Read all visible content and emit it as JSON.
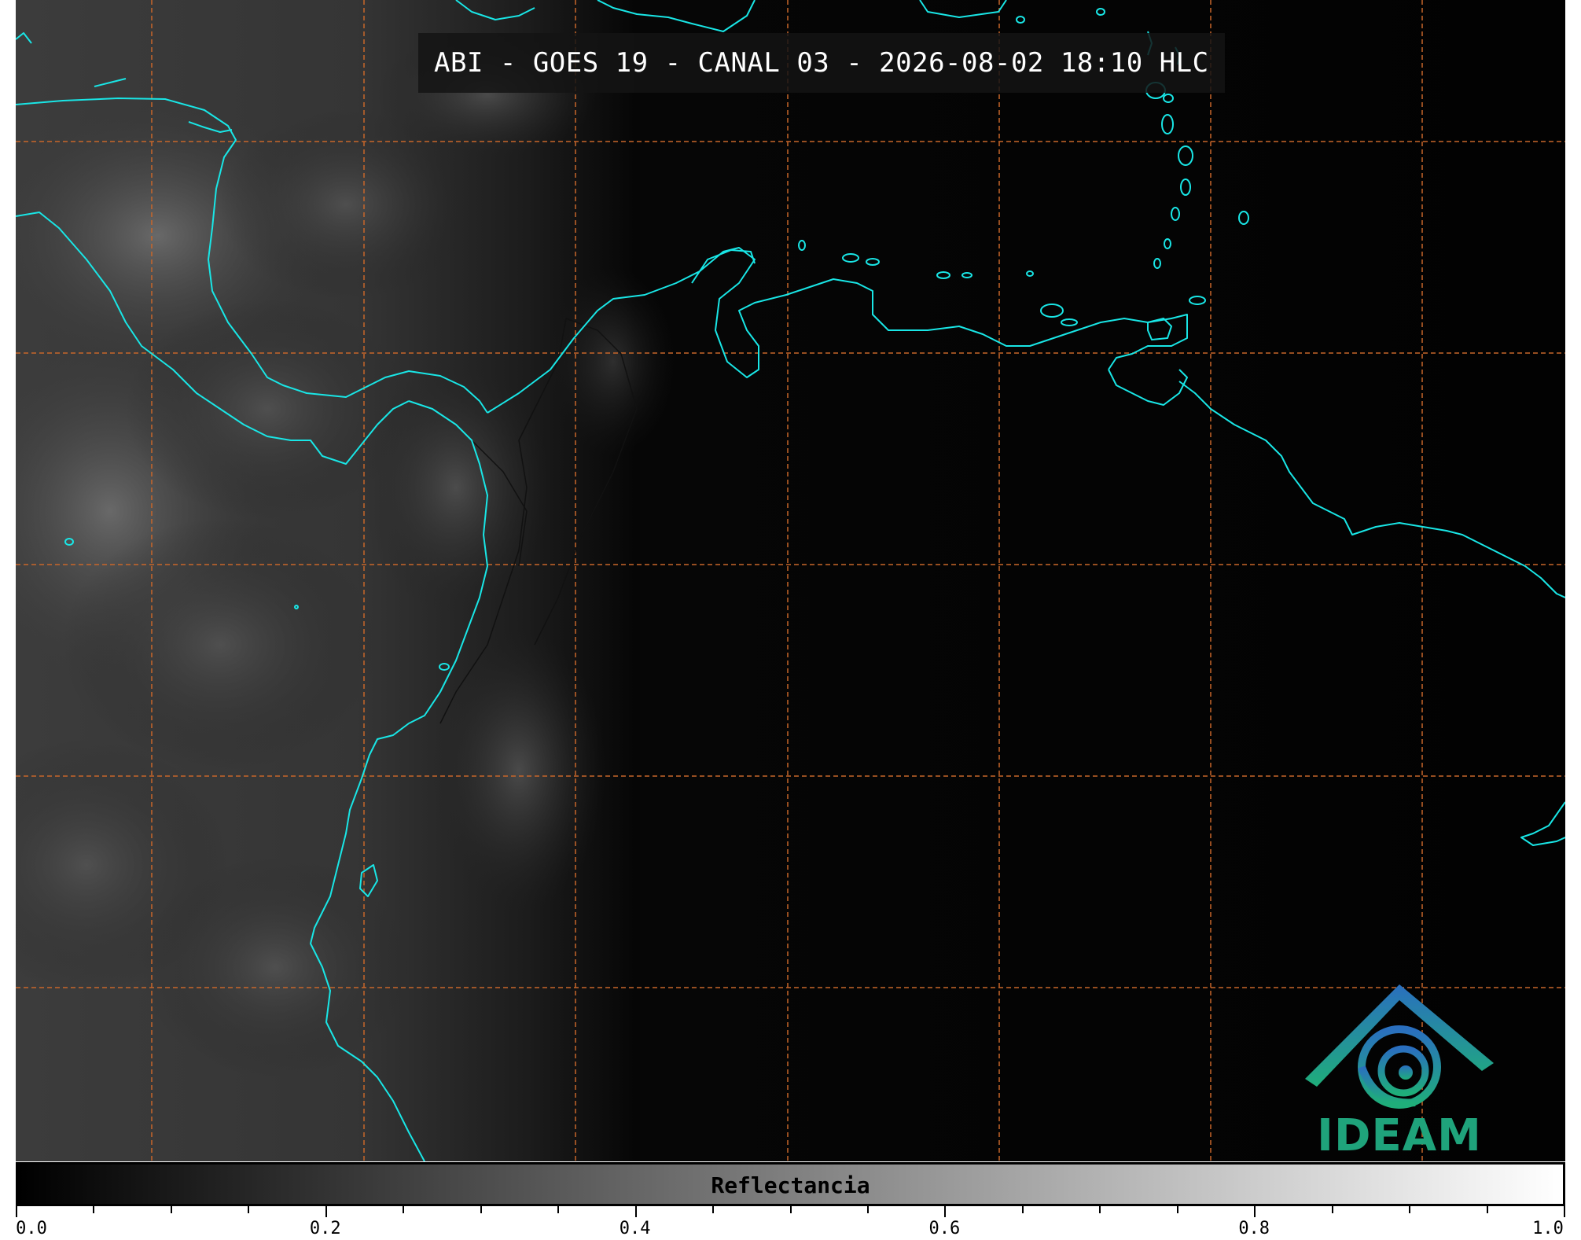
{
  "title": "ABI - GOES 19 - CANAL 03 - 2026-08-02 18:10 HLC",
  "colorbar": {
    "label": "Reflectancia",
    "min": 0.0,
    "max": 1.0,
    "ticks": [
      {
        "value": 0.0,
        "label": "0.0"
      },
      {
        "value": 0.2,
        "label": "0.2"
      },
      {
        "value": 0.4,
        "label": "0.4"
      },
      {
        "value": 0.6,
        "label": "0.6"
      },
      {
        "value": 0.8,
        "label": "0.8"
      },
      {
        "value": 1.0,
        "label": "1.0"
      }
    ],
    "minor_step": 0.05
  },
  "logo": {
    "text": "IDEAM"
  },
  "colors": {
    "coastline": "#19e6e6",
    "gridline": "#c8662a",
    "background": "#020202"
  },
  "map": {
    "gridlines": "on",
    "gridline_style": "dashed"
  }
}
